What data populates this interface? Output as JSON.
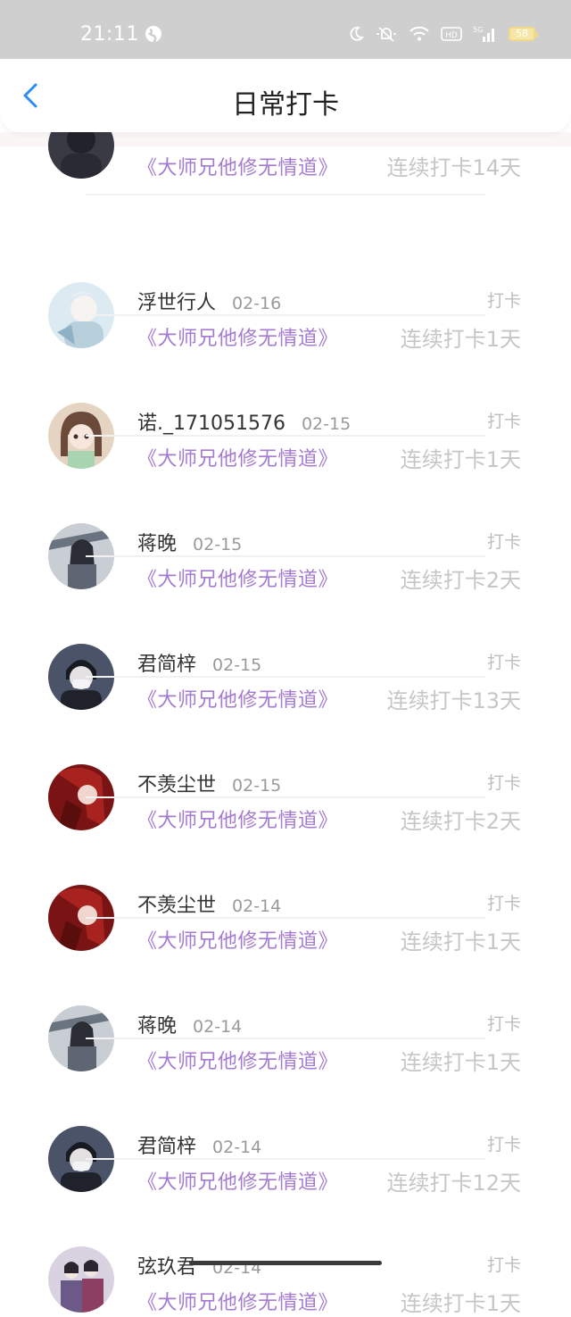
{
  "status_bar": {
    "time": "21:11",
    "battery": "58",
    "network": "5G",
    "hd": "HD"
  },
  "header": {
    "title": "日常打卡",
    "back_icon": "chevron-left-icon"
  },
  "colors": {
    "accent_blue": "#2b8cf1",
    "book_purple": "#a57bd1"
  },
  "entries": [
    {
      "name": "",
      "date": "",
      "book": "《大师兄他修无情道》",
      "action": "",
      "streak": "连续打卡14天",
      "avatar_bg": "#3a3a44"
    },
    {
      "name": "浮世行人",
      "date": "02-16",
      "book": "《大师兄他修无情道》",
      "action": "打卡",
      "streak": "连续打卡1天",
      "avatar_bg": "#cfe3ee"
    },
    {
      "name": "诺._171051576",
      "date": "02-15",
      "book": "《大师兄他修无情道》",
      "action": "打卡",
      "streak": "连续打卡1天",
      "avatar_bg": "#c9a98f"
    },
    {
      "name": "蒋晚",
      "date": "02-15",
      "book": "《大师兄他修无情道》",
      "action": "打卡",
      "streak": "连续打卡2天",
      "avatar_bg": "#7c8692"
    },
    {
      "name": "君简梓",
      "date": "02-15",
      "book": "《大师兄他修无情道》",
      "action": "打卡",
      "streak": "连续打卡13天",
      "avatar_bg": "#3b4254"
    },
    {
      "name": "不羡尘世",
      "date": "02-15",
      "book": "《大师兄他修无情道》",
      "action": "打卡",
      "streak": "连续打卡2天",
      "avatar_bg": "#8b1f1f"
    },
    {
      "name": "不羡尘世",
      "date": "02-14",
      "book": "《大师兄他修无情道》",
      "action": "打卡",
      "streak": "连续打卡1天",
      "avatar_bg": "#8b1f1f"
    },
    {
      "name": "蒋晚",
      "date": "02-14",
      "book": "《大师兄他修无情道》",
      "action": "打卡",
      "streak": "连续打卡1天",
      "avatar_bg": "#7c8692"
    },
    {
      "name": "君简梓",
      "date": "02-14",
      "book": "《大师兄他修无情道》",
      "action": "打卡",
      "streak": "连续打卡12天",
      "avatar_bg": "#3b4254"
    },
    {
      "name": "弦玖君",
      "date": "02-14",
      "book": "《大师兄他修无情道》",
      "action": "打卡",
      "streak": "连续打卡1天",
      "avatar_bg": "#8c7aa0"
    }
  ]
}
